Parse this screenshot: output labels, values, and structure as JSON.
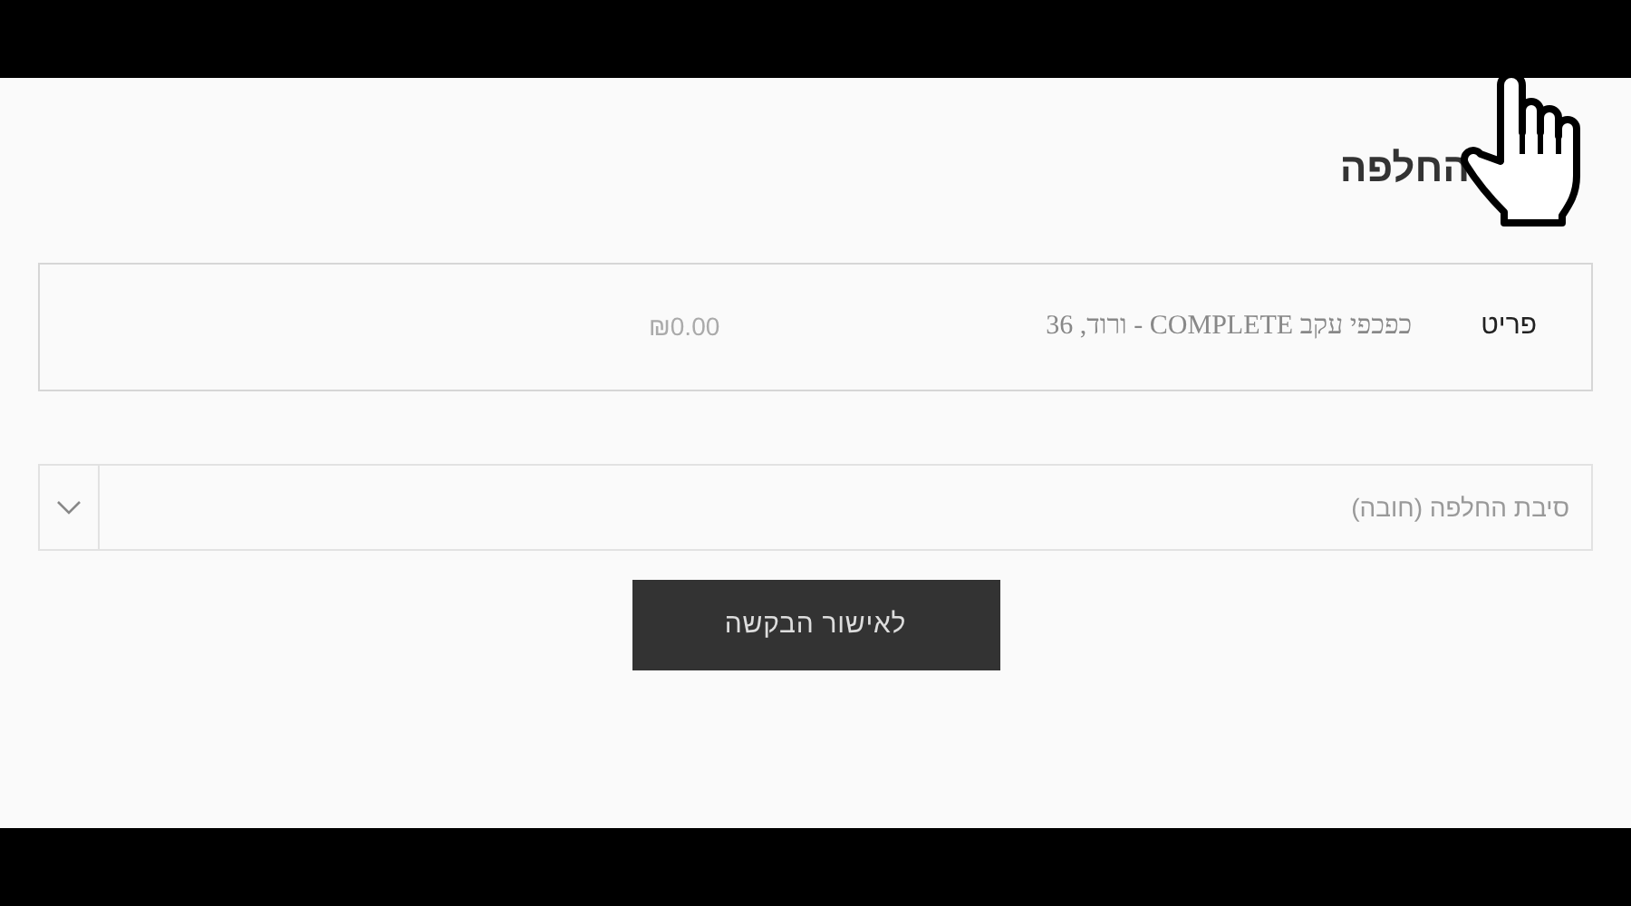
{
  "heading": "החלפה",
  "item": {
    "label": "פריט",
    "name": "כפכפי עקב COMPLETE - ורוד, 36",
    "price": "₪0.00"
  },
  "reason_select": {
    "placeholder": "סיבת החלפה (חובה)"
  },
  "submit_button": "לאישור הבקשה"
}
